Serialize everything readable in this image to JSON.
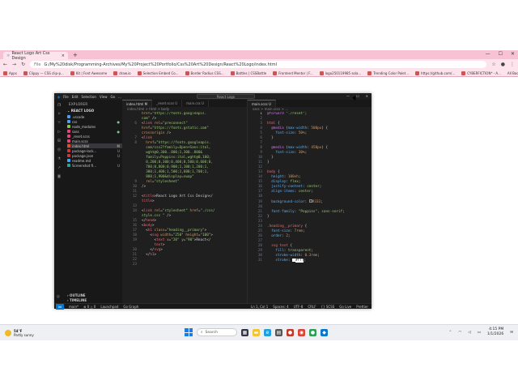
{
  "browser": {
    "tab_title": "React Logo Art Css Design",
    "tab_close": "×",
    "new_tab": "+",
    "url": "G:/My%20disk/Programming-Archives/My%20Project%20Portfolio/Css%20Art%20Design/React%20Logo/index.html",
    "file_label": "File",
    "bookmarks": [
      "Apps",
      "Clippy — CSS clip-p...",
      "Kit | Font Awesome",
      "draw.io",
      "Selection Embed Co...",
      "Border Radius CSS...",
      "Battles | CSSBattle",
      "Frontend Mentor | F...",
      "logo250119985 sola...",
      "Trending Color Palet...",
      "https://github.com/...",
      "CYBERFICTION* - A..."
    ],
    "all_bookmarks": "All Bookmarks"
  },
  "vscode": {
    "menu": [
      "File",
      "Edit",
      "Selection",
      "View",
      "Go",
      "..."
    ],
    "search": "React Logo",
    "explorer_title": "EXPLORER",
    "project": "REACT LOGO",
    "tree": [
      {
        "name": ".vscode",
        "color": "#4a9eff",
        "dot": ""
      },
      {
        "name": "css",
        "color": "#42a5f5",
        "dot": "●"
      },
      {
        "name": "node_modules",
        "color": "#8bc34a",
        "dot": ""
      },
      {
        "name": "sass",
        "color": "#ec407a",
        "dot": "●"
      },
      {
        "name": "_reset.scss",
        "color": "#ec407a",
        "dot": ""
      },
      {
        "name": "main.scss",
        "color": "#ec407a",
        "dot": ""
      },
      {
        "name": "index.html",
        "color": "#e44d26",
        "dot": "M"
      },
      {
        "name": "package-lock...",
        "color": "#cb3837",
        "dot": "U"
      },
      {
        "name": "package.json",
        "color": "#cb3837",
        "dot": "U"
      },
      {
        "name": "readme.md",
        "color": "#42a5f5",
        "dot": ""
      },
      {
        "name": "Screenshot fi...",
        "color": "#26a69a",
        "dot": "U"
      }
    ],
    "outline": "OUTLINE",
    "timeline": "TIMELINE",
    "left_tabs": [
      "index.html M",
      "_reset.scss U",
      "main.css U"
    ],
    "left_crumb": "index.html > html > body",
    "right_tabs": [
      "main.scss U"
    ],
    "right_crumb": "sass > main.scss > ...",
    "status_left": [
      "main*",
      "⊗ 0 △ 0",
      "Launchpad",
      "Go Graph"
    ],
    "status_right": [
      "Ln 1, Col 1",
      "Spaces: 4",
      "UTF-8",
      "CRLF",
      "{} SCSS",
      "Go Live",
      "Prettier"
    ]
  },
  "code_left": [
    {
      "n": "",
      "h": "<span class=\"a\">href</span>=<span class=\"s\">\"https://fonts.googleapis.</span>"
    },
    {
      "n": "",
      "h": "<span class=\"s\">com\"</span> /&gt;"
    },
    {
      "n": "6",
      "h": "&lt;<span class=\"t\">link</span> <span class=\"a\">rel</span>=<span class=\"s\">\"preconnect\"</span>"
    },
    {
      "n": "",
      "h": "<span class=\"a\">href</span>=<span class=\"s\">\"https://fonts.gstatic.com\"</span>"
    },
    {
      "n": "",
      "h": "<span class=\"a\">crossorigin</span> /&gt;"
    },
    {
      "n": "7",
      "h": "&lt;<span class=\"t\">link</span>"
    },
    {
      "n": "8",
      "h": "  <span class=\"a\">href</span>=<span class=\"s\">\"https://fonts.googleapis.</span>"
    },
    {
      "n": "",
      "h": "  <span class=\"s\">com/css2?family=Open+Sans:ital,</span>"
    },
    {
      "n": "",
      "h": "  <span class=\"s\">wght@0,300..800;1,300..800&amp;</span>"
    },
    {
      "n": "",
      "h": "  <span class=\"s\">family=Poppins:ital,wght@0,100;</span>"
    },
    {
      "n": "",
      "h": "  <span class=\"s\">0,200;0,300;0,400;0,500;0,600;0,</span>"
    },
    {
      "n": "",
      "h": "  <span class=\"s\">700;0,800;0,900;1,100;1,200;1,</span>"
    },
    {
      "n": "",
      "h": "  <span class=\"s\">300;1,400;1,500;1,600;1,700;1,</span>"
    },
    {
      "n": "",
      "h": "  <span class=\"s\">800;1,900&amp;display=swap\"</span>"
    },
    {
      "n": "9",
      "h": "  <span class=\"a\">rel</span>=<span class=\"s\">\"stylesheet\"</span>"
    },
    {
      "n": "10",
      "h": "/&gt;"
    },
    {
      "n": "11",
      "h": ""
    },
    {
      "n": "12",
      "h": "&lt;<span class=\"t\">title</span>&gt;React Logo Art Css Design&lt;/"
    },
    {
      "n": "",
      "h": "<span class=\"t\">title</span>&gt;"
    },
    {
      "n": "13",
      "h": ""
    },
    {
      "n": "14",
      "h": "&lt;<span class=\"t\">link</span> <span class=\"a\">rel</span>=<span class=\"s\">\"stylesheet\"</span> <span class=\"a\">href</span>=<span class=\"s\">\"./css/</span>"
    },
    {
      "n": "",
      "h": "<span class=\"s\">style.css \"</span> /&gt;"
    },
    {
      "n": "15",
      "h": "&lt;/<span class=\"t\">head</span>&gt;"
    },
    {
      "n": "16",
      "h": "&lt;<span class=\"t\">body</span>&gt;"
    },
    {
      "n": "17",
      "h": "  &lt;<span class=\"t\">h1</span> <span class=\"a\">class</span>=<span class=\"s\">\"heading__primary\"</span>&gt;"
    },
    {
      "n": "18",
      "h": "    &lt;<span class=\"t\">svg</span> <span class=\"a\">width</span>=<span class=\"s\">\"250\"</span> <span class=\"a\">height</span>=<span class=\"s\">\"100\"</span>&gt;"
    },
    {
      "n": "19",
      "h": "      &lt;<span class=\"t\">text</span> <span class=\"a\">x</span>=<span class=\"s\">\"20\"</span> <span class=\"a\">y</span>=<span class=\"s\">\"90\"</span>&gt;React&lt;/"
    },
    {
      "n": "",
      "h": "      <span class=\"t\">text</span>&gt;"
    },
    {
      "n": "20",
      "h": "    &lt;/<span class=\"t\">svg</span>&gt;"
    },
    {
      "n": "21",
      "h": "  &lt;/<span class=\"t\">h1</span>&gt;"
    },
    {
      "n": "22",
      "h": ""
    },
    {
      "n": "23",
      "h": ""
    }
  ],
  "code_right": [
    {
      "n": "1",
      "h": "<span class=\"k\">@forward</span> <span class=\"v\">\"./reset\"</span>;"
    },
    {
      "n": "2",
      "h": ""
    },
    {
      "n": "3",
      "h": "<span class=\"sel2\">html</span> {"
    },
    {
      "n": "4",
      "h": "  <span class=\"k\">@media</span> (<span class=\"pr\">max-width</span>: <span class=\"n\">500px</span>) {"
    },
    {
      "n": "5",
      "h": "    <span class=\"pr\">font-size</span>: <span class=\"n\">50%</span>;"
    },
    {
      "n": "6",
      "h": "  }"
    },
    {
      "n": "7",
      "h": ""
    },
    {
      "n": "8",
      "h": "  <span class=\"k\">@media</span> (<span class=\"pr\">max-width</span>: <span class=\"n\">450px</span>) {"
    },
    {
      "n": "9",
      "h": "    <span class=\"pr\">font-size</span>: <span class=\"n\">30%</span>;"
    },
    {
      "n": "10",
      "h": "  }"
    },
    {
      "n": "11",
      "h": "}"
    },
    {
      "n": "12",
      "h": ""
    },
    {
      "n": "13",
      "h": "<span class=\"sel2\">body</span> {"
    },
    {
      "n": "14",
      "h": "  <span class=\"pr\">height</span>: <span class=\"n\">100vh</span>;"
    },
    {
      "n": "15",
      "h": "  <span class=\"pr\">display</span>: <span class=\"v\">flex</span>;"
    },
    {
      "n": "16",
      "h": "  <span class=\"pr\">justify-content</span>: <span class=\"v\">center</span>;"
    },
    {
      "n": "17",
      "h": "  <span class=\"pr\">align-items</span>: <span class=\"v\">center</span>;"
    },
    {
      "n": "18",
      "h": ""
    },
    {
      "n": "19",
      "h": "  <span class=\"pr\">background-color</span>: <span style=\"display:inline-block;width:4px;height:4px;background:#333;border:1px solid #888;vertical-align:middle\"></span><span class=\"n\">#333</span>;"
    },
    {
      "n": "20",
      "h": ""
    },
    {
      "n": "21",
      "h": "  <span class=\"pr\">font-family</span>: <span class=\"v\">\"Poppins\", sans-serif</span>;"
    },
    {
      "n": "22",
      "h": "}"
    },
    {
      "n": "23",
      "h": ""
    },
    {
      "n": "24",
      "h": "<span class=\"sel2\">.heading__primary</span> {"
    },
    {
      "n": "25",
      "h": "  <span class=\"pr\">font-size</span>: <span class=\"n\">7rem</span>;"
    },
    {
      "n": "26",
      "h": "  <span class=\"pr\">order</span>: <span class=\"n\">2</span>;"
    },
    {
      "n": "27",
      "h": ""
    },
    {
      "n": "28",
      "h": "  <span class=\"sel2\">svg text</span> {"
    },
    {
      "n": "29",
      "h": "    <span class=\"pr\">fill</span>: <span class=\"v\">transparent</span>;"
    },
    {
      "n": "30",
      "h": "    <span class=\"pr\">stroke-width</span>: <span class=\"n\">0.3rem</span>;"
    },
    {
      "n": "31",
      "h": "    <span class=\"pr\">stroke</span>: <span style=\"display:inline-block;width:4px;height:4px;background:#fff;vertical-align:middle\"></span><span style=\"background:#fff;color:#000\">#fff</span>;"
    }
  ],
  "taskbar": {
    "temp": "54°F",
    "weather": "Partly sunny",
    "search": "Search",
    "time": "4:15 PM",
    "date": "1/1/2026"
  }
}
